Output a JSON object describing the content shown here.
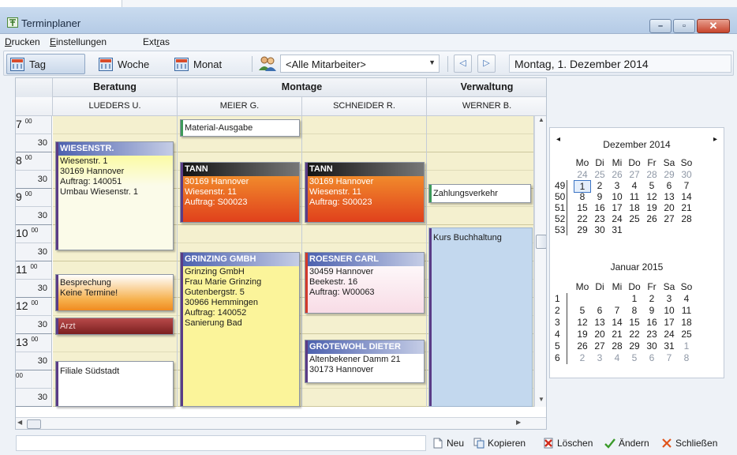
{
  "window": {
    "title": "Terminplaner"
  },
  "menu": {
    "items": [
      {
        "underline": "D",
        "rest": "rucken"
      },
      {
        "underline": "E",
        "rest": "instellungen"
      },
      {
        "pre": "Ext",
        "underline": "r",
        "rest": "as"
      }
    ]
  },
  "toolbar": {
    "view_day": "Tag",
    "view_week": "Woche",
    "view_month": "Monat",
    "employee_filter": "<Alle Mitarbeiter>",
    "current_date": "Montag, 1. Dezember 2014",
    "prev": "◁",
    "next": "▷"
  },
  "scheduler": {
    "groups": [
      "Beratung",
      "Montage",
      "Verwaltung"
    ],
    "employees": [
      "LUEDERS U.",
      "MEIER G.",
      "SCHNEIDER R.",
      "WERNER B."
    ],
    "hour_labels": [
      "7",
      "8",
      "9",
      "10",
      "11",
      "12",
      "13"
    ],
    "minute_label_hour": "00",
    "minute_label_half": "30",
    "appointments": {
      "material": {
        "lines": [
          "Material-Ausgabe"
        ]
      },
      "wiesenstr": {
        "title": "WIESENSTR.",
        "lines": [
          "Wiesenstr. 1",
          "30169 Hannover",
          "Auftrag: 140051",
          "Umbau Wiesenstr. 1"
        ]
      },
      "tann1": {
        "title": "TANN",
        "lines": [
          "30169 Hannover",
          "Wiesenstr. 11",
          "Auftrag: S00023"
        ]
      },
      "tann2": {
        "title": "TANN",
        "lines": [
          "30169 Hannover",
          "Wiesenstr. 11",
          "Auftrag: S00023"
        ]
      },
      "zahlung": {
        "lines": [
          "Zahlungsverkehr"
        ]
      },
      "kurs": {
        "lines": [
          "Kurs Buchhaltung"
        ]
      },
      "grinzing": {
        "title": "GRINZING GMBH",
        "lines": [
          "Grinzing GmbH",
          "Frau Marie Grinzing",
          "Gutenbergstr. 5",
          "30966 Hemmingen",
          "Auftrag: 140052",
          "Sanierung Bad"
        ]
      },
      "roesner": {
        "title": "ROESNER CARL",
        "lines": [
          "30459 Hannover",
          "Beekestr. 16",
          "Auftrag: W00063"
        ]
      },
      "besprechung": {
        "lines": [
          "Besprechung",
          "Keine Termine!"
        ]
      },
      "arzt": {
        "lines": [
          "Arzt"
        ]
      },
      "grotewohl": {
        "title": "GROTEWOHL DIETER",
        "lines": [
          "Altenbekener Damm 21",
          "30173 Hannover"
        ]
      },
      "filiale": {
        "lines": [
          "Filiale Südstadt"
        ]
      }
    }
  },
  "calendar": {
    "dec": {
      "title": "Dezember 2014",
      "dow": [
        "Mo",
        "Di",
        "Mi",
        "Do",
        "Fr",
        "Sa",
        "So"
      ],
      "weeks": [
        "49",
        "50",
        "51",
        "52",
        "53"
      ],
      "rows": [
        [
          "24",
          "25",
          "26",
          "27",
          "28",
          "29",
          "30"
        ],
        [
          "1",
          "2",
          "3",
          "4",
          "5",
          "6",
          "7"
        ],
        [
          "8",
          "9",
          "10",
          "11",
          "12",
          "13",
          "14"
        ],
        [
          "15",
          "16",
          "17",
          "18",
          "19",
          "20",
          "21"
        ],
        [
          "22",
          "23",
          "24",
          "25",
          "26",
          "27",
          "28"
        ],
        [
          "29",
          "30",
          "31",
          "",
          "",
          "",
          ""
        ]
      ]
    },
    "jan": {
      "title": "Januar 2015",
      "dow": [
        "Mo",
        "Di",
        "Mi",
        "Do",
        "Fr",
        "Sa",
        "So"
      ],
      "weeks": [
        "1",
        "2",
        "3",
        "4",
        "5",
        "6"
      ],
      "rows": [
        [
          "",
          "",
          "",
          "1",
          "2",
          "3",
          "4"
        ],
        [
          "5",
          "6",
          "7",
          "8",
          "9",
          "10",
          "11"
        ],
        [
          "12",
          "13",
          "14",
          "15",
          "16",
          "17",
          "18"
        ],
        [
          "19",
          "20",
          "21",
          "22",
          "23",
          "24",
          "25"
        ],
        [
          "26",
          "27",
          "28",
          "29",
          "30",
          "31",
          "1"
        ],
        [
          "2",
          "3",
          "4",
          "5",
          "6",
          "7",
          "8"
        ]
      ]
    },
    "nav_prev": "◂",
    "nav_next": "▸"
  },
  "statusbar": {
    "neu": "Neu",
    "kopieren": "Kopieren",
    "loeschen": "Löschen",
    "aendern": "Ändern",
    "schliessen": "Schließen"
  }
}
